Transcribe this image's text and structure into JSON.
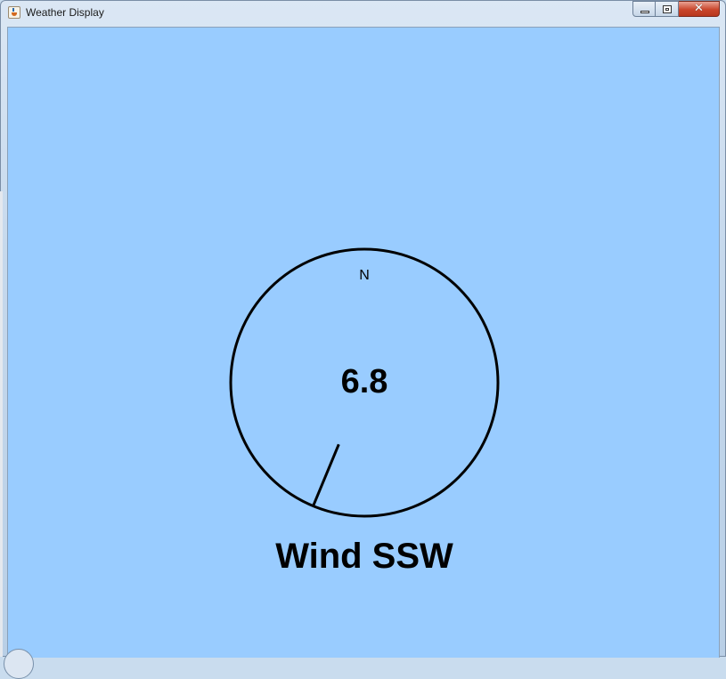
{
  "window": {
    "title": "Weather Display"
  },
  "caption_buttons": {
    "close_symbol": "✕"
  },
  "display": {
    "north_label": "N",
    "speed_value": "6.8",
    "direction_text": "Wind SSW",
    "direction_degrees": 202.5
  },
  "colors": {
    "background": "#99ccff",
    "dial": "#000000"
  }
}
